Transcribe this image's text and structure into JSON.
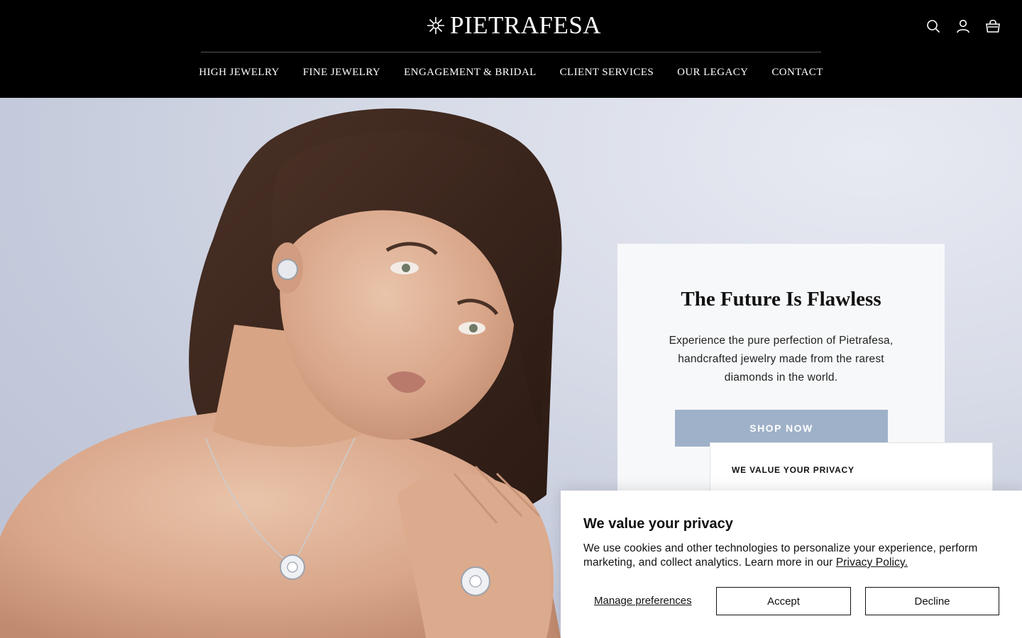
{
  "header": {
    "brand": "PIETRAFESA",
    "nav": [
      {
        "label": "HIGH JEWELRY"
      },
      {
        "label": "FINE JEWELRY"
      },
      {
        "label": "ENGAGEMENT & BRIDAL"
      },
      {
        "label": "CLIENT SERVICES"
      },
      {
        "label": "OUR LEGACY"
      },
      {
        "label": "CONTACT"
      }
    ],
    "icons": [
      "search-icon",
      "account-icon",
      "cart-icon"
    ]
  },
  "hero": {
    "title": "The Future Is Flawless",
    "body": "Experience the pure perfection of Pietrafesa, handcrafted jewelry made from the rarest diamonds in the world.",
    "cta": "SHOP NOW",
    "cta_color": "#9fb1c9"
  },
  "privacy_mini": {
    "title": "WE VALUE YOUR PRIVACY"
  },
  "cookie": {
    "title": "We value your privacy",
    "text": "We use cookies and other technologies to personalize your experience, perform marketing, and collect analytics. Learn more in our",
    "policy_link": "Privacy Policy.",
    "manage": "Manage preferences",
    "accept": "Accept",
    "decline": "Decline"
  }
}
